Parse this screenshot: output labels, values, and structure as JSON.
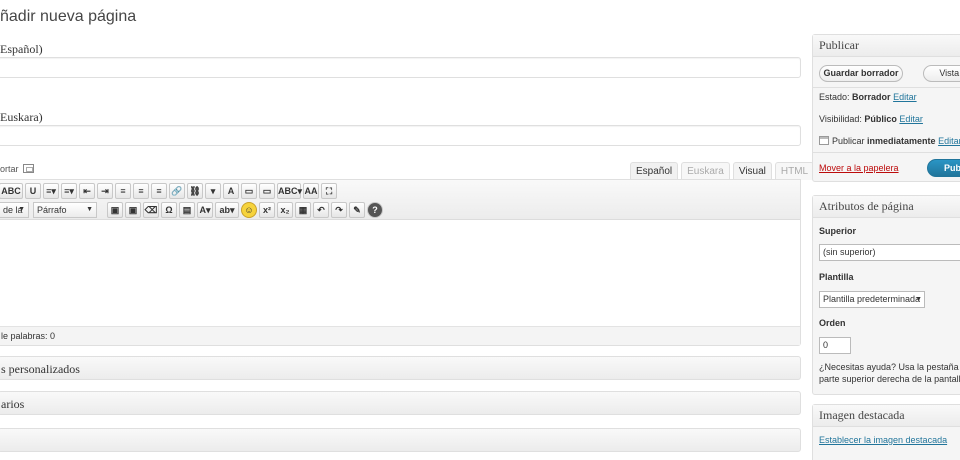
{
  "page": {
    "title": "ñadir nueva página"
  },
  "titles": [
    {
      "label": "Español)"
    },
    {
      "label": "Euskara)"
    }
  ],
  "editor": {
    "insert_label": "ortar",
    "tabs": [
      {
        "label": "Español",
        "state": "normal"
      },
      {
        "label": "Euskara",
        "state": "dim"
      },
      {
        "label": "Visual",
        "state": "active"
      },
      {
        "label": "HTML",
        "state": "dim"
      }
    ],
    "toolbar_row1": [
      "ABC",
      "U",
      "≡▾",
      "≡▾",
      "⇤",
      "⇥",
      "≡",
      "≡",
      "≡",
      "🔗",
      "⛓",
      "▾",
      "A",
      "▭",
      "▭",
      "ABC▾",
      "AA",
      "⛶"
    ],
    "format_select": "de la",
    "paragraph_select": "Párrafo",
    "toolbar_row2": [
      "▣",
      "▣",
      "⌫",
      "Ω",
      "▤",
      "A▾",
      "ab▾",
      "☺",
      "x²",
      "x₂",
      "▦",
      "↶",
      "↷",
      "✎",
      "?"
    ],
    "word_count": "le palabras: 0"
  },
  "metaboxes": [
    {
      "label": "s personalizados"
    },
    {
      "label": "arios"
    },
    {
      "label": ""
    }
  ],
  "publish": {
    "heading": "Publicar",
    "save_draft": "Guardar borrador",
    "preview": "Vista p",
    "status_label": "Estado:",
    "status_value": "Borrador",
    "status_edit": "Editar",
    "visibility_label": "Visibilidad:",
    "visibility_value": "Público",
    "visibility_edit": "Editar",
    "schedule_label": "Publicar",
    "schedule_value": "inmediatamente",
    "schedule_edit": "Editar",
    "trash": "Mover a la papelera",
    "publish": "Publi"
  },
  "attributes": {
    "heading": "Atributos de página",
    "parent_label": "Superior",
    "parent_value": "(sin superior)",
    "template_label": "Plantilla",
    "template_value": "Plantilla predeterminada",
    "order_label": "Orden",
    "order_value": "0",
    "help_line1": "¿Necesitas ayuda? Usa la pestaña Ayu",
    "help_line2": "parte superior derecha de la pantalla."
  },
  "featured": {
    "heading": "Imagen destacada",
    "link": "Establecer la imagen destacada"
  },
  "colors": {
    "link": "#21759b",
    "trash": "#bc0b0b",
    "primary": "#21759b"
  }
}
